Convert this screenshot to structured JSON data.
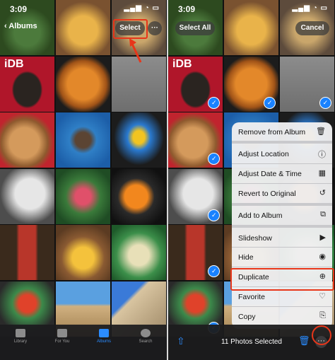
{
  "status": {
    "time": "3:09",
    "icons": "▂▄▆ ◔ ▭"
  },
  "left": {
    "back_label": "Albums",
    "select_label": "Select",
    "more_label": "···",
    "watermark": "iDB",
    "tabs": [
      {
        "label": "Library",
        "icon": "photo-stack-icon",
        "active": false
      },
      {
        "label": "For You",
        "icon": "for-you-icon",
        "active": false
      },
      {
        "label": "Albums",
        "icon": "albums-icon",
        "active": true
      },
      {
        "label": "Search",
        "icon": "search-icon",
        "active": false
      }
    ]
  },
  "right": {
    "select_all_label": "Select All",
    "cancel_label": "Cancel",
    "watermark": "iDB",
    "check_glyph": "✓",
    "selected_count": "11 Photos Selected",
    "share_glyph": "⇧",
    "trash_glyph": "🗑",
    "more_glyph": "···",
    "menu": [
      {
        "label": "Remove from Album",
        "icon": "🗑"
      },
      {
        "label": "Adjust Location",
        "icon": "ⓘ"
      },
      {
        "label": "Adjust Date & Time",
        "icon": "▦"
      },
      {
        "label": "Revert to Original",
        "icon": "↺"
      },
      {
        "label": "Add to Album",
        "icon": "⧉"
      },
      {
        "label": "Slideshow",
        "icon": "▶"
      },
      {
        "label": "Hide",
        "icon": "◉"
      },
      {
        "label": "Duplicate",
        "icon": "⊕"
      },
      {
        "label": "Favorite",
        "icon": "♡"
      },
      {
        "label": "Copy",
        "icon": "⎘"
      }
    ]
  },
  "colors": {
    "accent": "#2b8cff",
    "highlight": "#e8361a"
  }
}
